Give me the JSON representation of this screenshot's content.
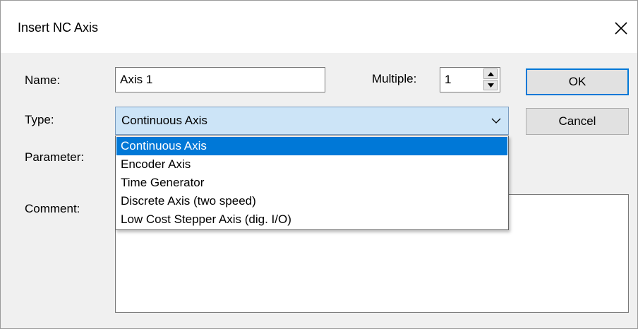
{
  "dialog": {
    "title": "Insert NC Axis"
  },
  "form": {
    "name_label": "Name:",
    "name_value": "Axis 1",
    "multiple_label": "Multiple:",
    "multiple_value": "1",
    "type_label": "Type:",
    "type_value": "Continuous Axis",
    "parameter_label": "Parameter:",
    "comment_label": "Comment:",
    "comment_value": ""
  },
  "buttons": {
    "ok": "OK",
    "cancel": "Cancel"
  },
  "type_options": [
    "Continuous Axis",
    "Encoder Axis",
    "Time Generator",
    "Discrete Axis (two speed)",
    "Low Cost Stepper Axis (dig. I/O)"
  ],
  "icons": {
    "close": "close-icon",
    "combo_arrow": "chevron-down-icon",
    "spin_up": "spin-up-icon",
    "spin_down": "spin-down-icon"
  },
  "colors": {
    "accent": "#0078d7",
    "combo_bg": "#cce4f7",
    "dialog_bg": "#f0f0f0"
  }
}
